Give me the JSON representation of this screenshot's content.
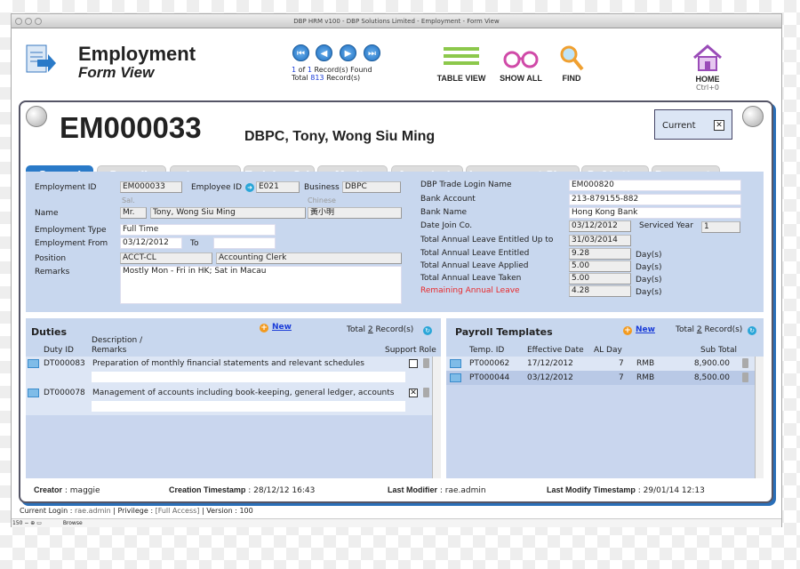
{
  "window": {
    "title": "DBP HRM v100 - DBP Solutions Limited - Employment - Form View"
  },
  "header": {
    "title": "Employment",
    "subtitle": "Form View",
    "icon": "document-arrow-icon"
  },
  "nav": {
    "found_current": "1",
    "found_of": "of",
    "found_total": "1",
    "found_suffix": "Record(s) Found",
    "total_prefix": "Total",
    "total_count": "813",
    "total_suffix": "Record(s)",
    "buttons": [
      "first-icon",
      "prev-icon",
      "next-icon",
      "last-icon"
    ]
  },
  "toolbar": {
    "table_view": "TABLE VIEW",
    "show_all": "SHOW ALL",
    "find": "FIND",
    "home": "HOME",
    "home_shortcut": "Ctrl+0"
  },
  "record": {
    "id": "EM000033",
    "name": "DBPC, Tony, Wong Siu Ming",
    "status_label": "Current",
    "status_checked": true
  },
  "tabs": [
    "General",
    "Payrolls",
    "Leaves",
    "Training Sch",
    "Merits",
    "Appraisals",
    "Improvement Plans",
    "Ref Letter",
    "Documents"
  ],
  "general": {
    "employment_id_label": "Employment ID",
    "employment_id": "EM000033",
    "employee_id_label": "Employee ID",
    "employee_id": "E021",
    "business_label": "Business",
    "business": "DBPC",
    "sal_hint": "Sal.",
    "chinese_hint": "Chinese",
    "name_label": "Name",
    "salutation": "Mr.",
    "name": "Tony, Wong Siu Ming",
    "chinese_name": "黃小明",
    "employment_type_label": "Employment Type",
    "employment_type": "Full Time",
    "employment_from_label": "Employment From",
    "employment_from": "03/12/2012",
    "to_label": "To",
    "employment_to": "",
    "position_label": "Position",
    "position_code": "ACCT-CL",
    "position_name": "Accounting Clerk",
    "remarks_label": "Remarks",
    "remarks": "Mostly Mon - Fri in HK; Sat in Macau",
    "login_label": "DBP Trade Login Name",
    "login": "EM000820",
    "bank_account_label": "Bank Account",
    "bank_account": "213-879155-882",
    "bank_name_label": "Bank Name",
    "bank_name": "Hong Kong Bank",
    "date_join_label": "Date Join Co.",
    "date_join": "03/12/2012",
    "serviced_year_label": "Serviced Year",
    "serviced_year": "1",
    "al_upto_label": "Total Annual Leave Entitled Up to",
    "al_upto": "31/03/2014",
    "al_entitled_label": "Total Annual Leave Entitled",
    "al_entitled": "9.28",
    "al_applied_label": "Total Annual Leave Applied",
    "al_applied": "5.00",
    "al_taken_label": "Total Annual Leave Taken",
    "al_taken": "5.00",
    "al_remaining_label": "Remaining Annual Leave",
    "al_remaining": "4.28",
    "days_unit": "Day(s)",
    "remaining_color": "#e8282a"
  },
  "duties": {
    "title": "Duties",
    "new_label": "New",
    "total_prefix": "Total",
    "total": "2",
    "total_suffix": "Record(s)",
    "columns": {
      "id": "Duty ID",
      "desc1": "Description /",
      "desc2": "Remarks",
      "support": "Support Role"
    },
    "rows": [
      {
        "id": "DT000083",
        "desc": "Preparation of monthly financial statements and relevant schedules",
        "support": false
      },
      {
        "id": "DT000078",
        "desc": "Management of accounts including book-keeping, general ledger, accounts",
        "support": true
      }
    ]
  },
  "payroll": {
    "title": "Payroll Templates",
    "new_label": "New",
    "total_prefix": "Total",
    "total": "2",
    "total_suffix": "Record(s)",
    "columns": {
      "id": "Temp. ID",
      "date": "Effective Date",
      "al": "AL Day",
      "subtotal": "Sub Total"
    },
    "rows": [
      {
        "id": "PT000062",
        "date": "17/12/2012",
        "al": "7",
        "currency": "RMB",
        "subtotal": "8,900.00"
      },
      {
        "id": "PT000044",
        "date": "03/12/2012",
        "al": "7",
        "currency": "RMB",
        "subtotal": "8,500.00"
      }
    ]
  },
  "audit": {
    "creator_label": "Creator",
    "creator": "maggie",
    "created_label": "Creation Timestamp",
    "created": "28/12/12 16:43",
    "modifier_label": "Last Modifier",
    "modifier": "rae.admin",
    "modified_label": "Last Modify Timestamp",
    "modified": "29/01/14 12:13"
  },
  "status": {
    "login_label": "Current Login :",
    "login": "rae.admin",
    "privilege_label": "| Privilege :",
    "privilege": "[Full Access]",
    "version_label": "| Version :",
    "version": "100"
  },
  "statusbar": {
    "zoom": "150",
    "mode": "Browse"
  }
}
